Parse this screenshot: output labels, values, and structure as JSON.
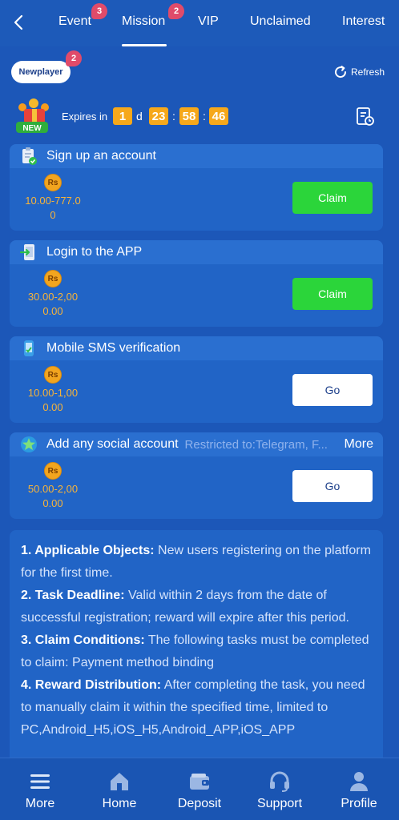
{
  "tabs": [
    {
      "label": "Event",
      "badge": "3"
    },
    {
      "label": "Mission",
      "badge": "2"
    },
    {
      "label": "VIP"
    },
    {
      "label": "Unclaimed"
    },
    {
      "label": "Interest"
    }
  ],
  "filter": {
    "label": "Newplayer",
    "badge": "2"
  },
  "refresh_label": "Refresh",
  "gift_badge": "NEW",
  "expires": {
    "label": "Expires in",
    "days": "1",
    "day_unit": "d",
    "hours": "23",
    "minutes": "58",
    "seconds": "46",
    "sep": ":"
  },
  "tasks": [
    {
      "title": "Sign up an account",
      "reward": "10.00-777.0",
      "reward2": "0",
      "button": "Claim",
      "icon": "clipboard-check-icon"
    },
    {
      "title": "Login to the APP",
      "reward": "30.00-2,00",
      "reward2": "0.00",
      "button": "Claim",
      "icon": "phone-login-icon"
    },
    {
      "title": "Mobile SMS verification",
      "reward": "10.00-1,00",
      "reward2": "0.00",
      "button": "Go",
      "icon": "sms-phone-icon"
    },
    {
      "title": "Add any social account",
      "restriction": "Restricted to:Telegram, F...",
      "more": "More",
      "reward": "50.00-2,00",
      "reward2": "0.00",
      "button": "Go",
      "icon": "social-star-icon"
    }
  ],
  "currency": "Rs",
  "rules": [
    {
      "head": "1. Applicable Objects:",
      "text": " New users registering on the platform for the first time."
    },
    {
      "head": "2. Task Deadline:",
      "text": " Valid within 2 days from the date of successful registration; reward will expire after this period."
    },
    {
      "head": "3. Claim Conditions:",
      "text": " The following tasks must be completed to claim: Payment method binding"
    },
    {
      "head": "4. Reward Distribution:",
      "text": " After completing the task, you need to manually claim it within the specified time, limited to PC,Android_H5,iOS_H5,Android_APP,iOS_APP"
    }
  ],
  "nav": [
    {
      "label": "More",
      "icon": "menu-icon"
    },
    {
      "label": "Home",
      "icon": "home-icon"
    },
    {
      "label": "Deposit",
      "icon": "wallet-icon"
    },
    {
      "label": "Support",
      "icon": "headset-icon"
    },
    {
      "label": "Profile",
      "icon": "user-icon"
    }
  ],
  "colors": {
    "background": "#1c57b8",
    "card": "#2164c6",
    "claim": "#2bd53a",
    "timer": "#f6a81b",
    "reward": "#f6b33a",
    "badge": "#e04b6a"
  }
}
